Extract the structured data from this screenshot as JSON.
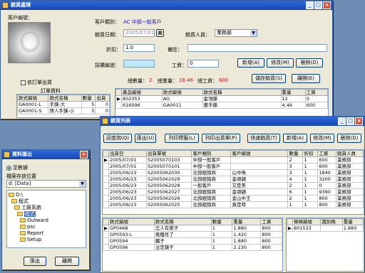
{
  "main_win": {
    "title": "銷貨處理",
    "customer_code_label": "客戶編號：",
    "customer_type_label": "客戶類別：",
    "customer_type_value": "AC 中部一般客戶",
    "date_label": "銷貨日期：",
    "date_value": "2005/07/01",
    "salesperson_label": "銷貨人員：",
    "salesperson_value": "業務部",
    "discount_label": "折扣：",
    "discount_value": "1.0",
    "remark_label": "備註：",
    "style_code_label": "採購編號：",
    "labor_label": "工資：",
    "labor_value": "0",
    "new_btn": "新增(A)",
    "edit_btn": "修改(M)",
    "delete_btn": "刪除(D)",
    "total_qty_label": "總數量：",
    "total_qty_value": "2",
    "total_weight_label": "總重量：",
    "total_weight_value": "16.46",
    "total_labor_label": "總工資：",
    "total_labor_value": "600",
    "save_btn": "儲存銷貨(S)",
    "leave_btn": "離開(E)",
    "order_only_label": "依訂單出貨",
    "order_title": "訂單資料",
    "order_headers": [
      "款式編號",
      "款式名稱",
      "數量",
      "出貨"
    ],
    "order_rows": [
      [
        "GA0001-L",
        "手鍊-大",
        "5",
        "0"
      ],
      [
        "GA0001-S",
        "情人手鍊-小",
        "5",
        "0"
      ]
    ],
    "items_headers": [
      "產品編號",
      "款式編號",
      "款式名稱",
      "重量",
      "工資"
    ],
    "items_rows": [
      [
        "802353",
        "AG",
        "金項鍊",
        "12",
        "0"
      ],
      [
        "616096",
        "GA0011",
        "畫手鍊",
        "4.46",
        "600"
      ]
    ]
  },
  "list_win": {
    "title": "銷貨列表",
    "buttons": [
      "回查詢(Q)",
      "匯出(U)",
      "列印標籤(L)",
      "列印出貨單(P)",
      "快速銷貨(T)",
      "新增(A)",
      "修改(M)",
      "刪除(D)"
    ],
    "headers": [
      "出貨日",
      "出貨單號",
      "客戶類別",
      "客戶編號",
      "數量",
      "折扣",
      "工資",
      "銷貨人員"
    ],
    "rows": [
      [
        "2005/07/01",
        "S2005070103",
        "中部一般客戶",
        "",
        "2",
        "1",
        "600",
        "業務部"
      ],
      [
        "2005/07/01",
        "S2005070101",
        "中部一般客戶",
        "",
        "3",
        "1",
        "600",
        "業務部"
      ],
      [
        "2005/06/23",
        "S2005062030",
        "北部經銷商",
        "山中珠",
        "3",
        "1",
        "1840",
        "業務部"
      ],
      [
        "2005/06/23",
        "S2005062029",
        "北部經銷商",
        "金頌韻",
        "4",
        "1",
        "3200",
        "業務部"
      ],
      [
        "2005/06/23",
        "S2005062028",
        "一般客戶",
        "又是美",
        "2",
        "1",
        "0",
        "業務部"
      ],
      [
        "2005/06/23",
        "S2005062027",
        "北部經銷商",
        "金頌韻",
        "6",
        "1",
        "9390",
        "業務部"
      ],
      [
        "2005/06/23",
        "S2005062026",
        "北部經銷商",
        "金山中王",
        "2",
        "1",
        "800",
        "業務部"
      ],
      [
        "2005/06/23",
        "S2005062025",
        "北部經銷商",
        "真是時",
        "1",
        "1",
        "800",
        "業務部"
      ]
    ],
    "detail_headers": [
      "款式編號",
      "款式名稱",
      "數量",
      "重量",
      "工資"
    ],
    "detail_rows": [
      [
        "GP0468",
        "怎人有愛子",
        "1",
        "1.880",
        "800"
      ],
      [
        "GP0593-L",
        "風鐵肖了",
        "1",
        "1.420",
        "800"
      ],
      [
        "GP0594",
        "臟子",
        "1",
        "1.880",
        "800"
      ],
      [
        "GP0596",
        "注定鍊子",
        "1",
        "2.230",
        "800"
      ]
    ],
    "side_headers": [
      "條碼編號",
      "識別碼",
      "重量"
    ],
    "side_rows": [
      [
        "801533",
        "",
        "1.880"
      ]
    ]
  },
  "export_win": {
    "title": "資料匯出",
    "radio_label": "至數據",
    "path_label": "檔案存放位置",
    "drive_value": "d: [Data]",
    "tree": [
      "D:\\",
      "程式",
      "工廠系統",
      "程式",
      "Outward",
      "psc",
      "Report",
      "Setup"
    ],
    "tree_selected": 3,
    "export_btn": "匯出",
    "leave_btn": "離開"
  }
}
